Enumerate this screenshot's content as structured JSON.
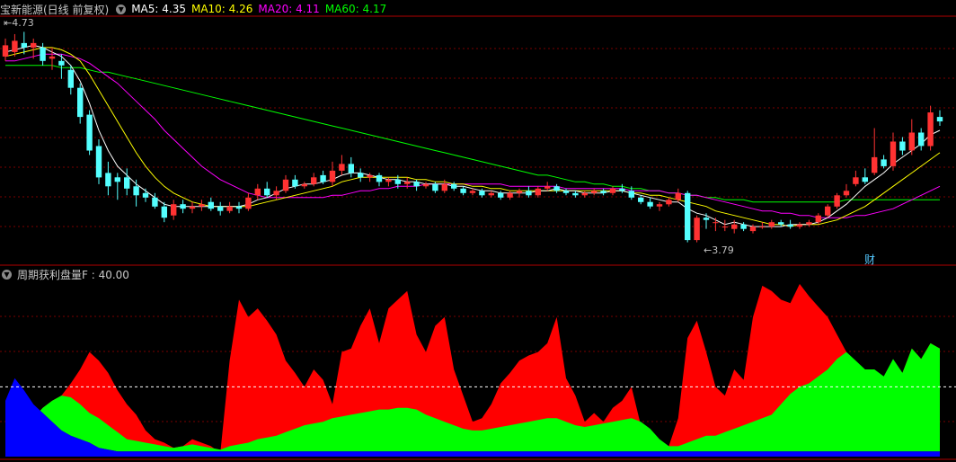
{
  "panel1": {
    "title": "宝新能源(日线 前复权)",
    "indicators": [
      {
        "label": "MA5: 4.35",
        "color": "#ffffff"
      },
      {
        "label": "MA10: 4.26",
        "color": "#ffff00"
      },
      {
        "label": "MA20: 4.11",
        "color": "#ff00ff"
      },
      {
        "label": "MA60: 4.17",
        "color": "#00ff00"
      }
    ],
    "high_label": "4.73",
    "low_label": "3.79",
    "event_label": "财"
  },
  "panel2": {
    "title": "周期获利盘量F : 40.00"
  },
  "colors": {
    "up": "#ff3232",
    "down": "#54ffff",
    "ma5": "#ffffff",
    "ma10": "#ffff00",
    "ma20": "#ff00ff",
    "ma60": "#00ff00",
    "profit_red": "#ff0000",
    "profit_green": "#00ff00",
    "profit_blue": "#0000ff",
    "grid": "#7a0000",
    "border": "#b00000"
  },
  "chart_data": {
    "type": "candlestick",
    "y_range": [
      3.7,
      4.8
    ],
    "candles": [
      [
        4.62,
        4.67,
        4.6,
        4.7
      ],
      [
        4.64,
        4.69,
        4.62,
        4.72
      ],
      [
        4.68,
        4.66,
        4.63,
        4.73
      ],
      [
        4.66,
        4.68,
        4.61,
        4.7
      ],
      [
        4.66,
        4.6,
        4.58,
        4.68
      ],
      [
        4.61,
        4.62,
        4.56,
        4.66
      ],
      [
        4.6,
        4.58,
        4.52,
        4.63
      ],
      [
        4.56,
        4.48,
        4.45,
        4.58
      ],
      [
        4.48,
        4.35,
        4.32,
        4.5
      ],
      [
        4.36,
        4.2,
        4.18,
        4.38
      ],
      [
        4.22,
        4.08,
        4.05,
        4.25
      ],
      [
        4.1,
        4.04,
        4.0,
        4.15
      ],
      [
        4.08,
        4.06,
        3.98,
        4.1
      ],
      [
        4.08,
        4.03,
        4.0,
        4.12
      ],
      [
        4.04,
        4.0,
        3.95,
        4.07
      ],
      [
        4.01,
        3.99,
        3.97,
        4.03
      ],
      [
        3.99,
        3.95,
        3.94,
        4.01
      ],
      [
        3.95,
        3.9,
        3.88,
        3.97
      ],
      [
        3.91,
        3.96,
        3.89,
        3.98
      ],
      [
        3.96,
        3.94,
        3.92,
        3.98
      ],
      [
        3.94,
        3.95,
        3.92,
        3.97
      ],
      [
        3.95,
        3.96,
        3.93,
        3.98
      ],
      [
        3.97,
        3.94,
        3.93,
        3.99
      ],
      [
        3.95,
        3.93,
        3.91,
        3.97
      ],
      [
        3.93,
        3.95,
        3.92,
        3.97
      ],
      [
        3.95,
        3.94,
        3.92,
        3.97
      ],
      [
        3.94,
        3.99,
        3.93,
        4.01
      ],
      [
        4.0,
        4.03,
        3.98,
        4.05
      ],
      [
        4.03,
        4.0,
        3.99,
        4.06
      ],
      [
        4.0,
        4.02,
        3.98,
        4.04
      ],
      [
        4.02,
        4.07,
        4.01,
        4.09
      ],
      [
        4.07,
        4.04,
        4.03,
        4.09
      ],
      [
        4.04,
        4.05,
        4.03,
        4.06
      ],
      [
        4.05,
        4.08,
        4.04,
        4.1
      ],
      [
        4.09,
        4.06,
        4.05,
        4.11
      ],
      [
        4.06,
        4.11,
        4.04,
        4.15
      ],
      [
        4.11,
        4.14,
        4.09,
        4.18
      ],
      [
        4.14,
        4.1,
        4.08,
        4.17
      ],
      [
        4.1,
        4.08,
        4.06,
        4.12
      ],
      [
        4.08,
        4.09,
        4.06,
        4.1
      ],
      [
        4.09,
        4.06,
        4.04,
        4.1
      ],
      [
        4.06,
        4.07,
        4.04,
        4.08
      ],
      [
        4.07,
        4.05,
        4.03,
        4.09
      ],
      [
        4.05,
        4.06,
        4.03,
        4.08
      ],
      [
        4.06,
        4.04,
        4.02,
        4.07
      ],
      [
        4.04,
        4.05,
        4.03,
        4.06
      ],
      [
        4.05,
        4.02,
        4.01,
        4.06
      ],
      [
        4.02,
        4.05,
        4.01,
        4.07
      ],
      [
        4.05,
        4.03,
        4.02,
        4.06
      ],
      [
        4.03,
        4.01,
        4.0,
        4.04
      ],
      [
        4.01,
        4.02,
        4.0,
        4.03
      ],
      [
        4.02,
        4.0,
        3.99,
        4.03
      ],
      [
        4.0,
        4.01,
        3.99,
        4.02
      ],
      [
        4.01,
        3.99,
        3.98,
        4.02
      ],
      [
        3.99,
        4.01,
        3.98,
        4.02
      ],
      [
        4.01,
        4.02,
        3.99,
        4.03
      ],
      [
        4.02,
        4.0,
        3.99,
        4.04
      ],
      [
        4.0,
        4.03,
        3.99,
        4.04
      ],
      [
        4.03,
        4.04,
        4.02,
        4.06
      ],
      [
        4.04,
        4.02,
        4.01,
        4.05
      ],
      [
        4.02,
        4.01,
        4.0,
        4.03
      ],
      [
        4.01,
        4.0,
        3.99,
        4.02
      ],
      [
        4.0,
        4.01,
        3.99,
        4.02
      ],
      [
        4.01,
        4.02,
        4.0,
        4.03
      ],
      [
        4.02,
        4.01,
        4.0,
        4.03
      ],
      [
        4.01,
        4.03,
        4.0,
        4.04
      ],
      [
        4.03,
        4.02,
        4.01,
        4.05
      ],
      [
        4.02,
        3.99,
        3.98,
        4.04
      ],
      [
        3.99,
        3.97,
        3.96,
        4.0
      ],
      [
        3.97,
        3.95,
        3.94,
        3.99
      ],
      [
        3.95,
        3.96,
        3.93,
        3.97
      ],
      [
        3.96,
        3.98,
        3.95,
        3.99
      ],
      [
        3.98,
        4.01,
        3.97,
        4.03
      ],
      [
        4.01,
        3.8,
        3.79,
        4.02
      ],
      [
        3.8,
        3.9,
        3.79,
        3.91
      ],
      [
        3.9,
        3.89,
        3.85,
        3.92
      ],
      [
        3.88,
        3.88,
        3.84,
        3.9
      ],
      [
        3.86,
        3.86,
        3.84,
        3.89
      ],
      [
        3.85,
        3.87,
        3.83,
        3.89
      ],
      [
        3.87,
        3.85,
        3.84,
        3.88
      ],
      [
        3.84,
        3.86,
        3.83,
        3.87
      ],
      [
        3.86,
        3.86,
        3.85,
        3.88
      ],
      [
        3.86,
        3.88,
        3.85,
        3.89
      ],
      [
        3.88,
        3.87,
        3.86,
        3.89
      ],
      [
        3.87,
        3.86,
        3.85,
        3.89
      ],
      [
        3.86,
        3.87,
        3.85,
        3.88
      ],
      [
        3.87,
        3.88,
        3.86,
        3.89
      ],
      [
        3.88,
        3.91,
        3.87,
        3.92
      ],
      [
        3.91,
        3.95,
        3.9,
        3.96
      ],
      [
        3.95,
        4.0,
        3.94,
        4.01
      ],
      [
        4.0,
        4.02,
        3.99,
        4.05
      ],
      [
        4.05,
        4.08,
        4.04,
        4.11
      ],
      [
        4.08,
        4.06,
        4.05,
        4.12
      ],
      [
        4.1,
        4.17,
        4.09,
        4.3
      ],
      [
        4.16,
        4.13,
        4.12,
        4.18
      ],
      [
        4.13,
        4.24,
        4.11,
        4.28
      ],
      [
        4.24,
        4.2,
        4.18,
        4.26
      ],
      [
        4.2,
        4.28,
        4.18,
        4.34
      ],
      [
        4.28,
        4.22,
        4.2,
        4.3
      ],
      [
        4.22,
        4.37,
        4.2,
        4.4
      ],
      [
        4.35,
        4.33,
        4.31,
        4.38
      ]
    ],
    "ma5": [
      4.64,
      4.65,
      4.66,
      4.67,
      4.66,
      4.64,
      4.62,
      4.58,
      4.51,
      4.41,
      4.29,
      4.2,
      4.13,
      4.09,
      4.05,
      4.02,
      3.99,
      3.96,
      3.95,
      3.95,
      3.95,
      3.95,
      3.95,
      3.95,
      3.95,
      3.95,
      3.96,
      3.98,
      3.99,
      4.01,
      4.03,
      4.04,
      4.05,
      4.05,
      4.06,
      4.07,
      4.09,
      4.1,
      4.1,
      4.09,
      4.08,
      4.07,
      4.07,
      4.06,
      4.06,
      4.05,
      4.05,
      4.05,
      4.04,
      4.04,
      4.03,
      4.02,
      4.02,
      4.01,
      4.01,
      4.01,
      4.01,
      4.02,
      4.02,
      4.03,
      4.02,
      4.02,
      4.01,
      4.01,
      4.01,
      4.02,
      4.02,
      4.01,
      4.0,
      3.99,
      3.98,
      3.97,
      3.97,
      3.94,
      3.92,
      3.91,
      3.89,
      3.87,
      3.88,
      3.87,
      3.86,
      3.86,
      3.86,
      3.86,
      3.87,
      3.87,
      3.87,
      3.88,
      3.9,
      3.93,
      3.96,
      4.0,
      4.04,
      4.07,
      4.1,
      4.14,
      4.17,
      4.2,
      4.23,
      4.27,
      4.29
    ],
    "ma10": [
      4.62,
      4.63,
      4.64,
      4.65,
      4.66,
      4.66,
      4.65,
      4.63,
      4.6,
      4.54,
      4.47,
      4.4,
      4.33,
      4.26,
      4.19,
      4.13,
      4.08,
      4.04,
      4.01,
      3.99,
      3.97,
      3.96,
      3.95,
      3.95,
      3.95,
      3.95,
      3.95,
      3.96,
      3.97,
      3.98,
      3.99,
      4.0,
      4.01,
      4.02,
      4.03,
      4.04,
      4.06,
      4.07,
      4.08,
      4.08,
      4.08,
      4.08,
      4.08,
      4.08,
      4.07,
      4.07,
      4.06,
      4.06,
      4.05,
      4.05,
      4.04,
      4.04,
      4.03,
      4.03,
      4.02,
      4.02,
      4.02,
      4.02,
      4.02,
      4.02,
      4.02,
      4.02,
      4.02,
      4.02,
      4.02,
      4.02,
      4.02,
      4.01,
      4.01,
      4.0,
      4.0,
      3.99,
      3.98,
      3.97,
      3.96,
      3.95,
      3.93,
      3.92,
      3.91,
      3.9,
      3.89,
      3.88,
      3.87,
      3.87,
      3.86,
      3.87,
      3.87,
      3.87,
      3.88,
      3.89,
      3.91,
      3.93,
      3.95,
      3.98,
      4.01,
      4.04,
      4.07,
      4.1,
      4.13,
      4.16,
      4.19
    ],
    "ma20": [
      4.6,
      4.6,
      4.61,
      4.62,
      4.63,
      4.63,
      4.63,
      4.62,
      4.61,
      4.59,
      4.56,
      4.53,
      4.5,
      4.46,
      4.42,
      4.38,
      4.34,
      4.29,
      4.25,
      4.21,
      4.17,
      4.13,
      4.1,
      4.07,
      4.05,
      4.03,
      4.01,
      4.0,
      3.99,
      3.99,
      3.99,
      3.99,
      3.99,
      3.99,
      3.99,
      4.0,
      4.0,
      4.01,
      4.02,
      4.02,
      4.03,
      4.03,
      4.04,
      4.04,
      4.04,
      4.05,
      4.05,
      4.05,
      4.05,
      4.05,
      4.05,
      4.05,
      4.05,
      4.05,
      4.04,
      4.04,
      4.04,
      4.04,
      4.04,
      4.04,
      4.03,
      4.03,
      4.03,
      4.03,
      4.03,
      4.03,
      4.03,
      4.02,
      4.02,
      4.02,
      4.02,
      4.01,
      4.01,
      4.0,
      4.0,
      3.99,
      3.98,
      3.97,
      3.96,
      3.95,
      3.94,
      3.93,
      3.93,
      3.92,
      3.92,
      3.91,
      3.91,
      3.9,
      3.9,
      3.9,
      3.9,
      3.91,
      3.91,
      3.92,
      3.93,
      3.94,
      3.96,
      3.98,
      4.0,
      4.02,
      4.04
    ],
    "ma60": [
      4.58,
      4.58,
      4.58,
      4.58,
      4.58,
      4.58,
      4.57,
      4.57,
      4.57,
      4.56,
      4.55,
      4.55,
      4.54,
      4.53,
      4.52,
      4.51,
      4.5,
      4.49,
      4.48,
      4.47,
      4.46,
      4.45,
      4.44,
      4.43,
      4.42,
      4.41,
      4.4,
      4.39,
      4.38,
      4.37,
      4.36,
      4.35,
      4.34,
      4.33,
      4.32,
      4.31,
      4.3,
      4.29,
      4.28,
      4.27,
      4.26,
      4.25,
      4.24,
      4.23,
      4.22,
      4.21,
      4.2,
      4.19,
      4.18,
      4.17,
      4.16,
      4.15,
      4.14,
      4.13,
      4.12,
      4.11,
      4.1,
      4.09,
      4.09,
      4.08,
      4.07,
      4.06,
      4.06,
      4.05,
      4.05,
      4.04,
      4.04,
      4.03,
      4.03,
      4.02,
      4.02,
      4.01,
      4.01,
      4.0,
      4.0,
      3.99,
      3.99,
      3.98,
      3.98,
      3.98,
      3.97,
      3.97,
      3.97,
      3.97,
      3.97,
      3.97,
      3.97,
      3.97,
      3.97,
      3.97,
      3.98,
      3.98,
      3.98,
      3.98,
      3.98,
      3.98,
      3.98,
      3.98,
      3.98,
      3.98,
      3.98
    ],
    "profit_indicator": {
      "y_range": [
        0,
        100
      ],
      "reference_line": 40,
      "red_top": [
        32,
        22,
        18,
        22,
        28,
        32,
        35,
        42,
        50,
        60,
        55,
        48,
        38,
        30,
        24,
        15,
        10,
        8,
        5,
        6,
        10,
        8,
        6,
        2,
        55,
        90,
        80,
        85,
        78,
        70,
        55,
        48,
        40,
        50,
        44,
        30,
        60,
        62,
        75,
        85,
        65,
        85,
        90,
        95,
        70,
        60,
        75,
        80,
        50,
        35,
        20,
        22,
        30,
        42,
        48,
        55,
        58,
        60,
        65,
        80,
        45,
        35,
        20,
        25,
        20,
        28,
        32,
        40,
        18,
        8,
        2,
        6,
        22,
        68,
        78,
        60,
        40,
        35,
        50,
        44,
        80,
        98,
        95,
        90,
        88,
        99,
        92,
        86,
        80,
        70,
        60,
        52,
        50,
        45,
        40,
        52,
        48,
        62,
        56,
        65,
        62
      ],
      "green_top": [
        32,
        22,
        18,
        22,
        28,
        32,
        35,
        34,
        30,
        25,
        22,
        18,
        14,
        10,
        9,
        8,
        7,
        6,
        5,
        6,
        7,
        6,
        5,
        4,
        6,
        7,
        8,
        10,
        11,
        12,
        14,
        16,
        18,
        19,
        20,
        22,
        23,
        24,
        25,
        26,
        27,
        27,
        28,
        28,
        27,
        24,
        22,
        20,
        18,
        16,
        15,
        15,
        16,
        17,
        18,
        19,
        20,
        21,
        22,
        22,
        20,
        18,
        17,
        18,
        19,
        20,
        21,
        22,
        20,
        16,
        10,
        6,
        6,
        8,
        10,
        12,
        12,
        14,
        16,
        18,
        20,
        22,
        24,
        30,
        36,
        40,
        42,
        46,
        50,
        56,
        60,
        55,
        50,
        50,
        46,
        56,
        48,
        62,
        56,
        65,
        62
      ],
      "blue_top": [
        32,
        45,
        38,
        30,
        25,
        20,
        15,
        12,
        10,
        8,
        5,
        4,
        3,
        3,
        3,
        3,
        3,
        3,
        3,
        3,
        3,
        3,
        3,
        3,
        3,
        3,
        3,
        3,
        3,
        3,
        3,
        3,
        3,
        3,
        3,
        3,
        3,
        3,
        3,
        3,
        3,
        3,
        3,
        3,
        3,
        3,
        3,
        3,
        3,
        3,
        3,
        3,
        3,
        3,
        3,
        3,
        3,
        3,
        3,
        3,
        3,
        3,
        3,
        3,
        3,
        3,
        3,
        3,
        3,
        3,
        3,
        3,
        3,
        3,
        3,
        3,
        3,
        3,
        3,
        3,
        3,
        3,
        3,
        3,
        3,
        3,
        3,
        3,
        3,
        3,
        3,
        3,
        3,
        3,
        3,
        3,
        3,
        3,
        3,
        3,
        3
      ]
    }
  }
}
